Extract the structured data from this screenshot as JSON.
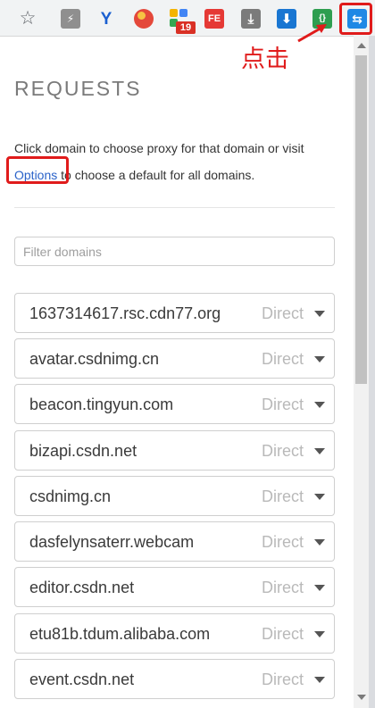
{
  "toolbar": {
    "icons": [
      "star-icon",
      "bolt-extension-icon",
      "y-extension-icon",
      "ball-extension-icon",
      "grid-extension-icon",
      "fe-extension-icon",
      "download-icon",
      "download-blue-icon",
      "code-extension-icon",
      "proxy-extension-icon"
    ],
    "badge_count": "19",
    "fe_label": "FE",
    "code_label": "{}",
    "y_label": "Y"
  },
  "annotation": {
    "label": "点击",
    "color": "#e01b1b"
  },
  "panel": {
    "title": "REQUESTS",
    "intro_before": "Click domain to choose proxy for that domain or visit ",
    "options_link": "Options",
    "intro_after": " to choose a default for all domains.",
    "filter_placeholder": "Filter domains"
  },
  "domains": [
    {
      "name": "1637314617.rsc.cdn77.org",
      "proxy": "Direct"
    },
    {
      "name": "avatar.csdnimg.cn",
      "proxy": "Direct"
    },
    {
      "name": "beacon.tingyun.com",
      "proxy": "Direct"
    },
    {
      "name": "bizapi.csdn.net",
      "proxy": "Direct"
    },
    {
      "name": "csdnimg.cn",
      "proxy": "Direct"
    },
    {
      "name": "dasfelynsaterr.webcam",
      "proxy": "Direct"
    },
    {
      "name": "editor.csdn.net",
      "proxy": "Direct"
    },
    {
      "name": "etu81b.tdum.alibaba.com",
      "proxy": "Direct"
    },
    {
      "name": "event.csdn.net",
      "proxy": "Direct"
    }
  ],
  "colors": {
    "link": "#2a62c9",
    "highlight": "#e01b1b",
    "proxy_text": "#b9b9b9"
  }
}
